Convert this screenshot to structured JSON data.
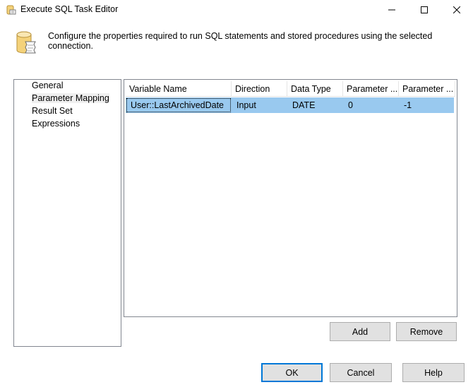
{
  "window": {
    "title": "Execute SQL Task Editor",
    "minimize_icon": "minimize-icon",
    "maximize_icon": "maximize-icon",
    "close_icon": "close-icon"
  },
  "header": {
    "icon": "database-script-icon",
    "description": "Configure the properties required to run SQL statements and stored procedures using the selected connection."
  },
  "nav": {
    "items": [
      {
        "label": "General"
      },
      {
        "label": "Parameter Mapping",
        "selected": true
      },
      {
        "label": "Result Set"
      },
      {
        "label": "Expressions"
      }
    ]
  },
  "grid": {
    "columns": [
      "Variable Name",
      "Direction",
      "Data Type",
      "Parameter ...",
      "Parameter ..."
    ],
    "rows": [
      [
        "User::LastArchivedDate",
        "Input",
        "DATE",
        "0",
        "-1"
      ]
    ]
  },
  "buttons": {
    "add": "Add",
    "remove": "Remove",
    "ok": "OK",
    "cancel": "Cancel",
    "help": "Help"
  },
  "colors": {
    "selection": "#99c9ef",
    "default_button_border": "#0078d7"
  }
}
